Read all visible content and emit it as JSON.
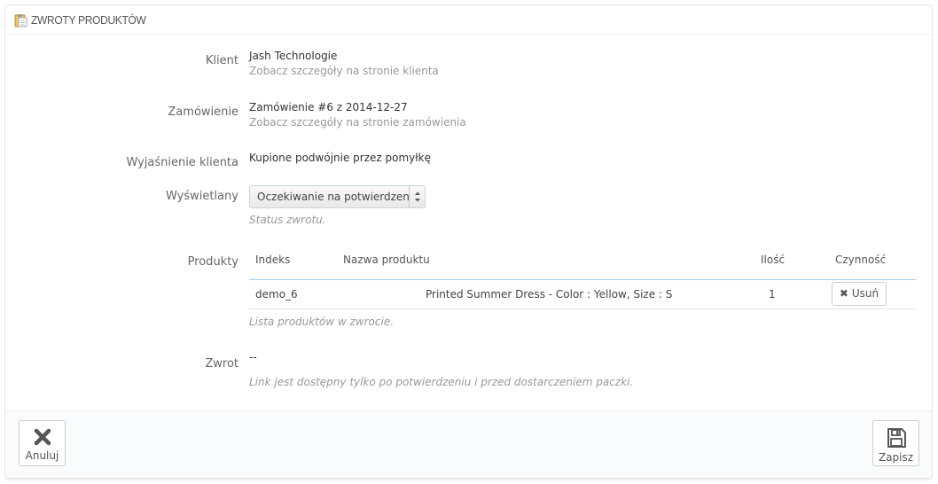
{
  "panel": {
    "title": "ZWROTY PRODUKTÓW",
    "icon": "clipboard-icon"
  },
  "client": {
    "label": "Klient",
    "name": "Jash Technologie",
    "link": "Zobacz szczegóły na stronie klienta"
  },
  "order": {
    "label": "Zamówienie",
    "value": "Zamówienie #6 z 2014-12-27",
    "link": "Zobacz szczegóły na stronie zamówienia"
  },
  "explanation": {
    "label": "Wyjaśnienie klienta",
    "value": "Kupione podwójnie przez pomyłkę"
  },
  "status": {
    "label": "Wyświetlany",
    "selected": "Oczekiwanie na potwierdzenie",
    "help": "Status zwrotu."
  },
  "products": {
    "label": "Produkty",
    "headers": {
      "index": "Indeks",
      "name": "Nazwa produktu",
      "qty": "Ilość",
      "action": "Czynność"
    },
    "rows": [
      {
        "index": "demo_6",
        "name": "Printed Summer Dress - Color : Yellow, Size : S",
        "qty": "1",
        "action": "Usuń"
      }
    ],
    "help": "Lista produktów w zwrocie."
  },
  "return": {
    "label": "Zwrot",
    "value": "--",
    "help": "Link jest dostępny tylko po potwierdzeniu i przed dostarczeniem paczki."
  },
  "footer": {
    "cancel_label": "Anuluj",
    "save_label": "Zapisz"
  },
  "colors": {
    "table_header_border": "#a0d0eb",
    "panel_border": "#e6e6e6"
  }
}
